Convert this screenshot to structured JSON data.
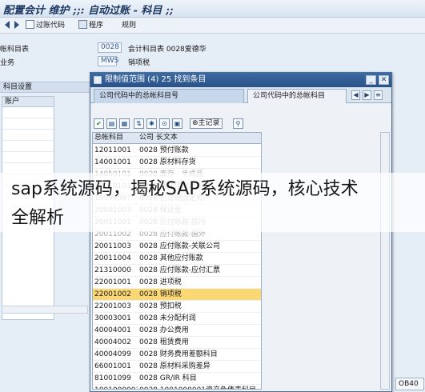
{
  "window": {
    "title": "配置会计 维护 ;;: 自动过账 - 科目 ;;"
  },
  "toolbar": {
    "posting_code_label": "过账代码",
    "procedure_label": "程序",
    "rules_label": "规则"
  },
  "form": {
    "chart_of_accounts_label": "帐科目表",
    "chart_of_accounts_value": "0028",
    "chart_of_accounts_desc": "会计科目表 0028爱德华",
    "transaction_label": "业务",
    "transaction_value": "MWS",
    "transaction_desc": "销项税",
    "section_title": "科目设置",
    "table_header": "账户"
  },
  "popup": {
    "title": "限制值范围 (4)  25 找到条目",
    "tab_active": "公司代码中的总帐科目号",
    "tab_inactive": "公司代码中的总帐科目",
    "main_record_label": "主记录",
    "columns": {
      "account": "总帐科目",
      "company_text": "公司 长文本"
    },
    "rows": [
      {
        "account": "12011001",
        "company_text": "0028 预付账款",
        "state": "normal"
      },
      {
        "account": "14001001",
        "company_text": "0028 原材料存货",
        "state": "normal"
      },
      {
        "account": "14050101",
        "company_text": "0028 库存 - 半成品",
        "state": "faded"
      },
      {
        "account": "18010101",
        "company_text": "0028 待处理财产损溢",
        "state": "faded"
      },
      {
        "account": "19999997",
        "company_text": "0028 已过期固定资产",
        "state": "faded"
      },
      {
        "account": "20001003",
        "company_text": "0028 保证金",
        "state": "faded"
      },
      {
        "account": "20011001",
        "company_text": "0028 应付账款-国内",
        "state": "faded"
      },
      {
        "account": "20011002",
        "company_text": "0028 应付账款-国外",
        "state": "faded"
      },
      {
        "account": "20011003",
        "company_text": "0028 应付账款-关联公司",
        "state": "normal"
      },
      {
        "account": "20011004",
        "company_text": "0028 其他应付账款",
        "state": "normal"
      },
      {
        "account": "21310000",
        "company_text": "0028 应付账款-应付汇票",
        "state": "normal"
      },
      {
        "account": "22001001",
        "company_text": "0028 进项税",
        "state": "normal"
      },
      {
        "account": "22001002",
        "company_text": "0028 销项税",
        "state": "selected"
      },
      {
        "account": "22001003",
        "company_text": "0028 预扣税",
        "state": "normal"
      },
      {
        "account": "30003001",
        "company_text": "0028 未分配利润",
        "state": "normal"
      },
      {
        "account": "40004001",
        "company_text": "0028 办公费用",
        "state": "normal"
      },
      {
        "account": "40004002",
        "company_text": "0028 租赁费用",
        "state": "normal"
      },
      {
        "account": "40004099",
        "company_text": "0028 财务费用差额科目",
        "state": "normal"
      },
      {
        "account": "66001001",
        "company_text": "0028 原材料采购差异",
        "state": "normal"
      },
      {
        "account": "81001099",
        "company_text": "0028 GR/IR 科目",
        "state": "normal"
      },
      {
        "account": "1001000001",
        "company_text": "0028 1001000001资产负债表科目",
        "state": "normal"
      }
    ]
  },
  "status_badge": "OB40",
  "overlay": {
    "line1": "sap系统源码，揭秘SAP系统源码，核心技术",
    "line2": "全解析"
  },
  "icons": [
    "back-icon",
    "forward-icon",
    "list-icon",
    "procedure-icon",
    "check-icon",
    "filter-icon",
    "find-icon",
    "sort-icon",
    "main-record-icon",
    "help-icon"
  ]
}
